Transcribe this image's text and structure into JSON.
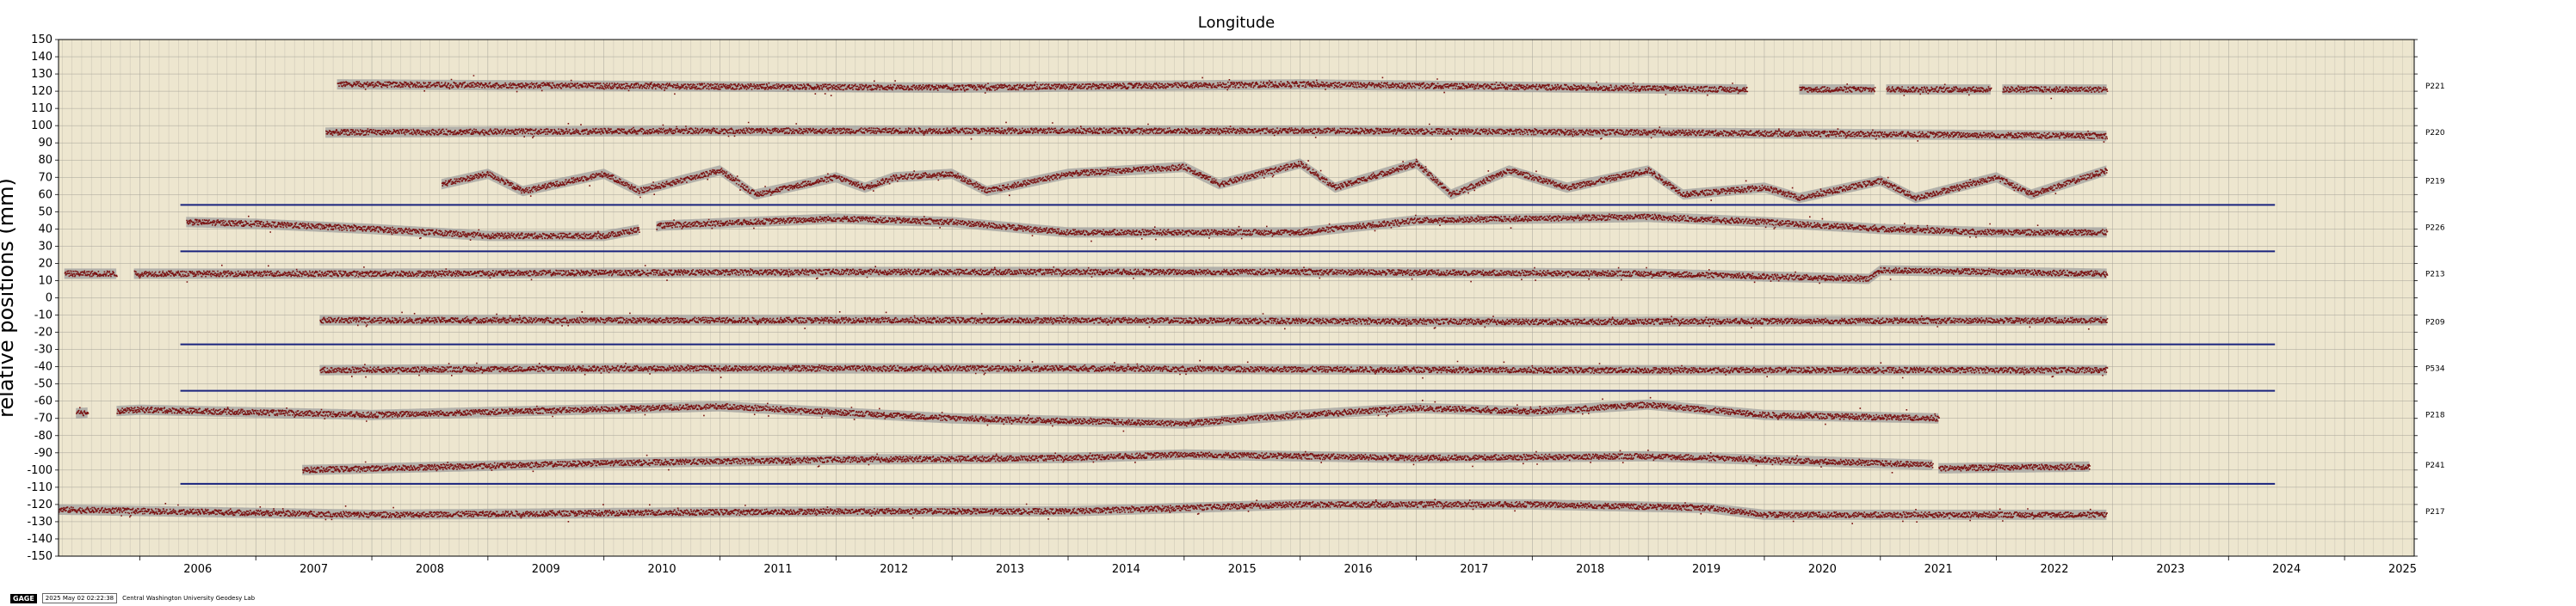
{
  "chart_data": {
    "type": "scatter",
    "title": "Longitude",
    "ylabel": "relative positions (mm)",
    "xlim": [
      2005.3,
      2025.6
    ],
    "ylim": [
      -150,
      150
    ],
    "yticks": [
      150,
      140,
      130,
      120,
      110,
      100,
      90,
      80,
      70,
      60,
      50,
      40,
      30,
      20,
      10,
      0,
      -10,
      -20,
      -30,
      -40,
      -50,
      -60,
      -70,
      -80,
      -90,
      -100,
      -110,
      -120,
      -130,
      -140,
      -150
    ],
    "xtick_labels": [
      "2006",
      "2007",
      "2008",
      "2009",
      "2010",
      "2011",
      "2012",
      "2013",
      "2014",
      "2015",
      "2016",
      "2017",
      "2018",
      "2019",
      "2020",
      "2021",
      "2022",
      "2023",
      "2024",
      "2025"
    ],
    "grid": true,
    "background": "#ede6cf",
    "point_color": "#7a1212",
    "band_color": "#9a9a9a",
    "line_color": "#1a237e",
    "reference_lines": [
      {
        "y": 54,
        "x": [
          2006.35,
          2024.4
        ]
      },
      {
        "y": 27,
        "x": [
          2006.35,
          2024.4
        ]
      },
      {
        "y": -27,
        "x": [
          2006.35,
          2024.4
        ]
      },
      {
        "y": -54,
        "x": [
          2006.35,
          2024.4
        ]
      },
      {
        "y": -108,
        "x": [
          2006.35,
          2024.4
        ]
      }
    ],
    "series": [
      {
        "name": "P221",
        "offset": 123,
        "segments": [
          [
            2007.7,
            2019.85
          ],
          [
            2020.3,
            2020.95
          ],
          [
            2021.05,
            2021.95
          ],
          [
            2022.05,
            2022.95
          ]
        ],
        "trend": [
          [
            2007.7,
            124
          ],
          [
            2013,
            122
          ],
          [
            2016,
            124
          ],
          [
            2019.8,
            121
          ],
          [
            2020.3,
            121
          ],
          [
            2022.95,
            121
          ]
        ]
      },
      {
        "name": "P220",
        "offset": 96,
        "segments": [
          [
            2007.6,
            2022.95
          ]
        ],
        "trend": [
          [
            2007.6,
            96
          ],
          [
            2011,
            97
          ],
          [
            2016,
            97
          ],
          [
            2019,
            96
          ],
          [
            2022.95,
            94
          ]
        ]
      },
      {
        "name": "P219",
        "offset": 68,
        "segments": [
          [
            2008.6,
            2022.95
          ]
        ],
        "trend": [
          [
            2008.6,
            66
          ],
          [
            2009,
            72
          ],
          [
            2009.3,
            62
          ],
          [
            2010,
            72
          ],
          [
            2010.3,
            62
          ],
          [
            2011,
            74
          ],
          [
            2011.3,
            60
          ],
          [
            2012,
            70
          ],
          [
            2012.25,
            64
          ],
          [
            2012.5,
            70
          ],
          [
            2013,
            72
          ],
          [
            2013.3,
            62
          ],
          [
            2014,
            72
          ],
          [
            2015,
            76
          ],
          [
            2015.3,
            66
          ],
          [
            2016,
            78
          ],
          [
            2016.3,
            64
          ],
          [
            2017,
            78
          ],
          [
            2017.3,
            60
          ],
          [
            2017.8,
            74
          ],
          [
            2018.3,
            64
          ],
          [
            2019,
            74
          ],
          [
            2019.3,
            60
          ],
          [
            2020,
            64
          ],
          [
            2020.3,
            58
          ],
          [
            2021,
            68
          ],
          [
            2021.3,
            58
          ],
          [
            2022,
            70
          ],
          [
            2022.3,
            60
          ],
          [
            2022.95,
            74
          ]
        ]
      },
      {
        "name": "P226",
        "offset": 41,
        "segments": [
          [
            2006.4,
            2010.3
          ],
          [
            2010.45,
            2022.95
          ]
        ],
        "trend": [
          [
            2006.4,
            44
          ],
          [
            2007,
            43
          ],
          [
            2008,
            40
          ],
          [
            2009,
            36
          ],
          [
            2010,
            36
          ],
          [
            2010.5,
            42
          ],
          [
            2012,
            46
          ],
          [
            2013,
            44
          ],
          [
            2014,
            38
          ],
          [
            2016,
            38
          ],
          [
            2017,
            45
          ],
          [
            2018,
            46
          ],
          [
            2019,
            47
          ],
          [
            2020,
            44
          ],
          [
            2021,
            40
          ],
          [
            2022,
            38
          ],
          [
            2022.95,
            38
          ]
        ]
      },
      {
        "name": "P213",
        "offset": 14,
        "segments": [
          [
            2005.35,
            2005.8
          ],
          [
            2005.95,
            2022.95
          ]
        ],
        "trend": [
          [
            2005.35,
            14
          ],
          [
            2008,
            14
          ],
          [
            2012,
            15
          ],
          [
            2016,
            15
          ],
          [
            2019,
            14
          ],
          [
            2020.9,
            11
          ],
          [
            2021,
            16
          ],
          [
            2022.95,
            14
          ]
        ]
      },
      {
        "name": "P209",
        "offset": -14,
        "segments": [
          [
            2007.55,
            2022.95
          ]
        ],
        "trend": [
          [
            2007.55,
            -13
          ],
          [
            2010,
            -13
          ],
          [
            2014,
            -13
          ],
          [
            2018,
            -14
          ],
          [
            2022.95,
            -13
          ]
        ]
      },
      {
        "name": "P534",
        "offset": -41,
        "segments": [
          [
            2007.55,
            2022.95
          ]
        ],
        "trend": [
          [
            2007.55,
            -42
          ],
          [
            2010,
            -41
          ],
          [
            2014,
            -41
          ],
          [
            2018,
            -42
          ],
          [
            2022.95,
            -42
          ]
        ]
      },
      {
        "name": "P218",
        "offset": -68,
        "segments": [
          [
            2005.45,
            2005.55
          ],
          [
            2005.8,
            2021.5
          ]
        ],
        "trend": [
          [
            2005.45,
            -67
          ],
          [
            2006,
            -65
          ],
          [
            2008,
            -68
          ],
          [
            2011,
            -63
          ],
          [
            2013,
            -70
          ],
          [
            2015,
            -73
          ],
          [
            2016,
            -68
          ],
          [
            2017,
            -64
          ],
          [
            2018,
            -66
          ],
          [
            2019,
            -62
          ],
          [
            2020,
            -68
          ],
          [
            2021.5,
            -70
          ]
        ]
      },
      {
        "name": "P241",
        "offset": -97,
        "segments": [
          [
            2007.4,
            2021.45
          ],
          [
            2021.5,
            2022.8
          ]
        ],
        "trend": [
          [
            2007.4,
            -100
          ],
          [
            2010,
            -96
          ],
          [
            2012,
            -94
          ],
          [
            2014,
            -93
          ],
          [
            2015,
            -91
          ],
          [
            2017,
            -93
          ],
          [
            2019,
            -92
          ],
          [
            2021.45,
            -97
          ],
          [
            2021.5,
            -99
          ],
          [
            2022.8,
            -98
          ]
        ]
      },
      {
        "name": "P217",
        "offset": -124,
        "segments": [
          [
            2005.3,
            2022.95
          ]
        ],
        "trend": [
          [
            2005.3,
            -123
          ],
          [
            2008,
            -126
          ],
          [
            2012,
            -124
          ],
          [
            2014,
            -124
          ],
          [
            2016,
            -120
          ],
          [
            2018,
            -120
          ],
          [
            2019.5,
            -122
          ],
          [
            2020,
            -126
          ],
          [
            2022.95,
            -126
          ]
        ]
      }
    ]
  },
  "footer": {
    "badge": "GAGE",
    "timestamp": "2025 May 02 02:22:38",
    "lab": "Central Washington University Geodesy Lab"
  }
}
